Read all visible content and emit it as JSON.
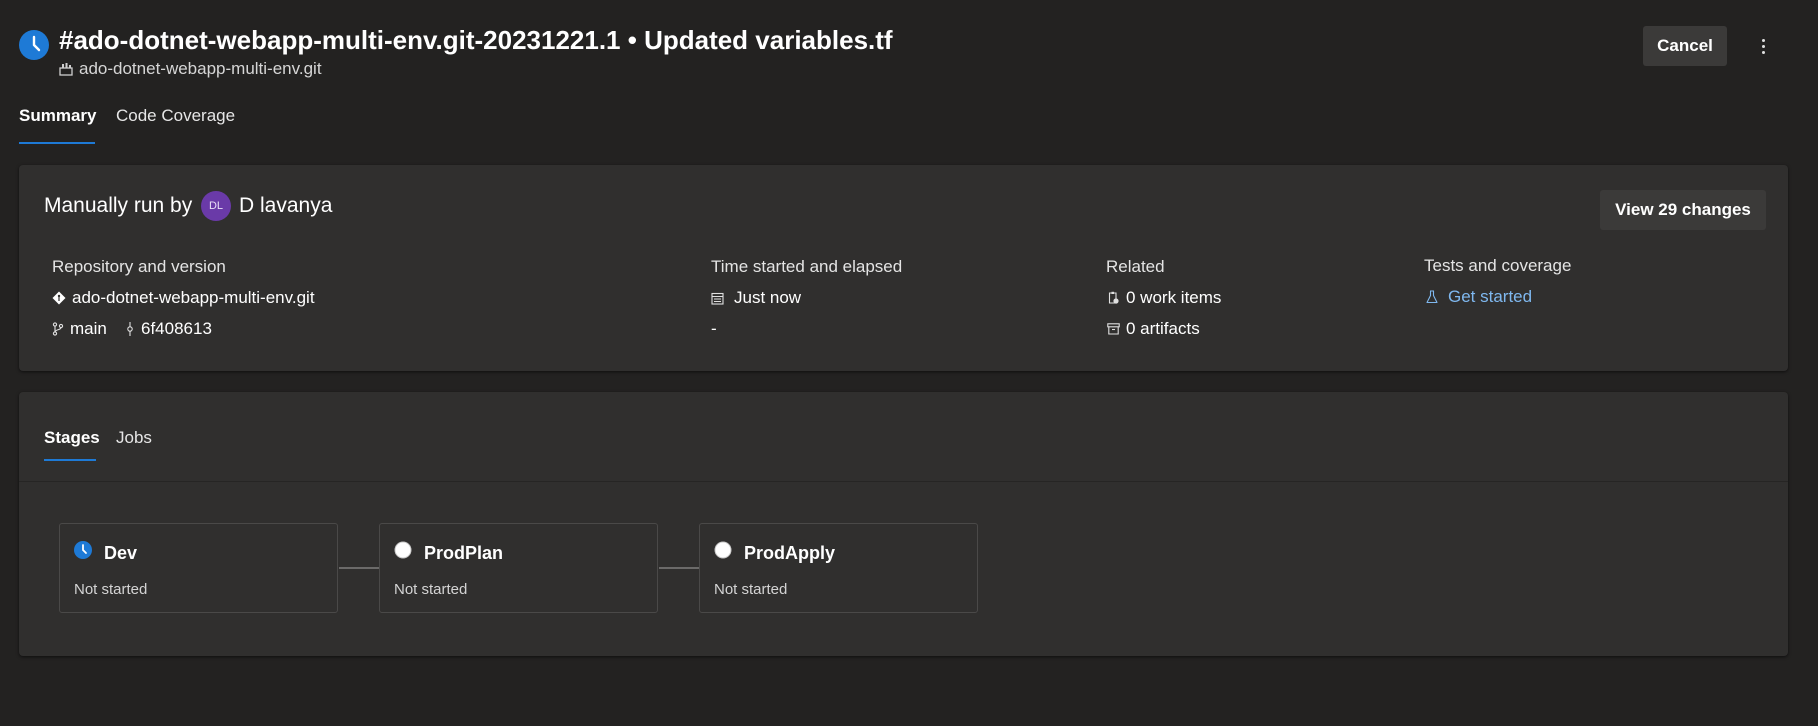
{
  "header": {
    "title": "#ado-dotnet-webapp-multi-env.git-20231221.1 • Updated variables.tf",
    "repo": "ado-dotnet-webapp-multi-env.git",
    "status_icon": "clock-icon",
    "cancel_label": "Cancel",
    "more_icon": "more-vertical-icon"
  },
  "tabs": [
    {
      "label": "Summary",
      "active": true
    },
    {
      "label": "Code Coverage",
      "active": false
    }
  ],
  "summary": {
    "run_by_prefix": "Manually run by",
    "avatar_initials": "DL",
    "run_by_name": "D lavanya",
    "view_changes_label": "View 29 changes",
    "repo_section": {
      "heading": "Repository and version",
      "repo_name": "ado-dotnet-webapp-multi-env.git",
      "branch": "main",
      "commit": "6f408613"
    },
    "time_section": {
      "heading": "Time started and elapsed",
      "started": "Just now",
      "elapsed": "-"
    },
    "related_section": {
      "heading": "Related",
      "work_items": "0 work items",
      "artifacts": "0 artifacts"
    },
    "tests_section": {
      "heading": "Tests and coverage",
      "link": "Get started"
    }
  },
  "stages_panel": {
    "tabs": [
      {
        "label": "Stages",
        "active": true
      },
      {
        "label": "Jobs",
        "active": false
      }
    ],
    "stages": [
      {
        "name": "Dev",
        "status": "Not started",
        "icon": "clock-icon"
      },
      {
        "name": "ProdPlan",
        "status": "Not started",
        "icon": "empty-circle-icon"
      },
      {
        "name": "ProdApply",
        "status": "Not started",
        "icon": "empty-circle-icon"
      }
    ]
  },
  "colors": {
    "background": "#232221",
    "card": "#302f2e",
    "accent": "#1e7ad6",
    "link": "#7fb8ef",
    "avatar": "#6a3aa8"
  }
}
